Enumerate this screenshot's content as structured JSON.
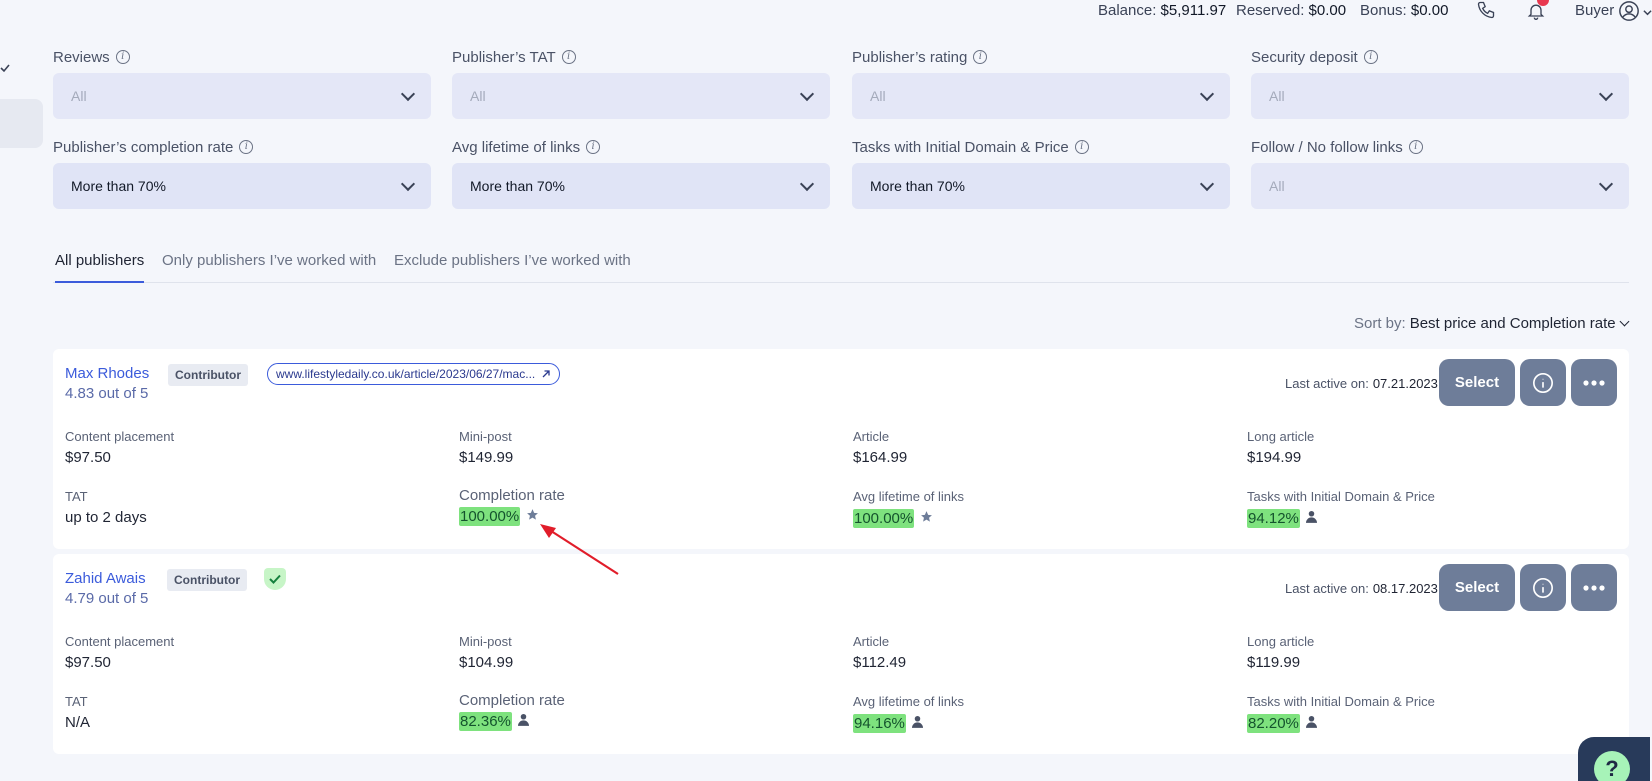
{
  "header": {
    "balance_label": "Balance:",
    "balance_value": "$5,911.97",
    "reserved_label": "Reserved:",
    "reserved_value": "$0.00",
    "bonus_label": "Bonus:",
    "bonus_value": "$0.00",
    "role": "Buyer"
  },
  "filters": [
    {
      "label": "Reviews",
      "value": "All"
    },
    {
      "label": "Publisher’s TAT",
      "value": "All"
    },
    {
      "label": "Publisher’s rating",
      "value": "All"
    },
    {
      "label": "Security deposit",
      "value": "All"
    },
    {
      "label": "Publisher’s completion rate",
      "value": "More than 70%"
    },
    {
      "label": "Avg lifetime of links",
      "value": "More than 70%"
    },
    {
      "label": "Tasks with Initial Domain & Price",
      "value": "More than 70%"
    },
    {
      "label": "Follow / No follow links",
      "value": "All"
    }
  ],
  "tabs": [
    {
      "label": "All publishers"
    },
    {
      "label": "Only publishers I’ve worked with"
    },
    {
      "label": "Exclude publishers I’ve worked with"
    }
  ],
  "sort": {
    "label": "Sort by:",
    "value": "Best price and Completion rate"
  },
  "publishers": [
    {
      "name": "Max Rhodes",
      "rating": "4.83 out of 5",
      "badge": "Contributor",
      "url": "www.lifestyledaily.co.uk/article/2023/06/27/mac...",
      "last_active_label": "Last active on:",
      "last_active": "07.21.2023",
      "select_label": "Select",
      "content_placement_label": "Content placement",
      "content_placement": "$97.50",
      "mini_post_label": "Mini-post",
      "mini_post": "$149.99",
      "article_label": "Article",
      "article": "$164.99",
      "long_article_label": "Long article",
      "long_article": "$194.99",
      "tat_label": "TAT",
      "tat": "up to 2 days",
      "completion_label": "Completion rate",
      "completion": "100.00%",
      "lifetime_label": "Avg lifetime of links",
      "lifetime": "100.00%",
      "tasks_label": "Tasks with Initial Domain & Price",
      "tasks": "94.12%"
    },
    {
      "name": "Zahid Awais",
      "rating": "4.79 out of 5",
      "badge": "Contributor",
      "last_active_label": "Last active on:",
      "last_active": "08.17.2023",
      "select_label": "Select",
      "content_placement_label": "Content placement",
      "content_placement": "$97.50",
      "mini_post_label": "Mini-post",
      "mini_post": "$104.99",
      "article_label": "Article",
      "article": "$112.49",
      "long_article_label": "Long article",
      "long_article": "$119.99",
      "tat_label": "TAT",
      "tat": "N/A",
      "completion_label": "Completion rate",
      "completion": "82.36%",
      "lifetime_label": "Avg lifetime of links",
      "lifetime": "94.16%",
      "tasks_label": "Tasks with Initial Domain & Price",
      "tasks": "82.20%"
    }
  ],
  "help_label": "?",
  "colors": {
    "accent": "#3b5bdb",
    "button": "#6e7d99",
    "highlight": "#7ee27e",
    "annotation_arrow": "#e11d2a"
  }
}
